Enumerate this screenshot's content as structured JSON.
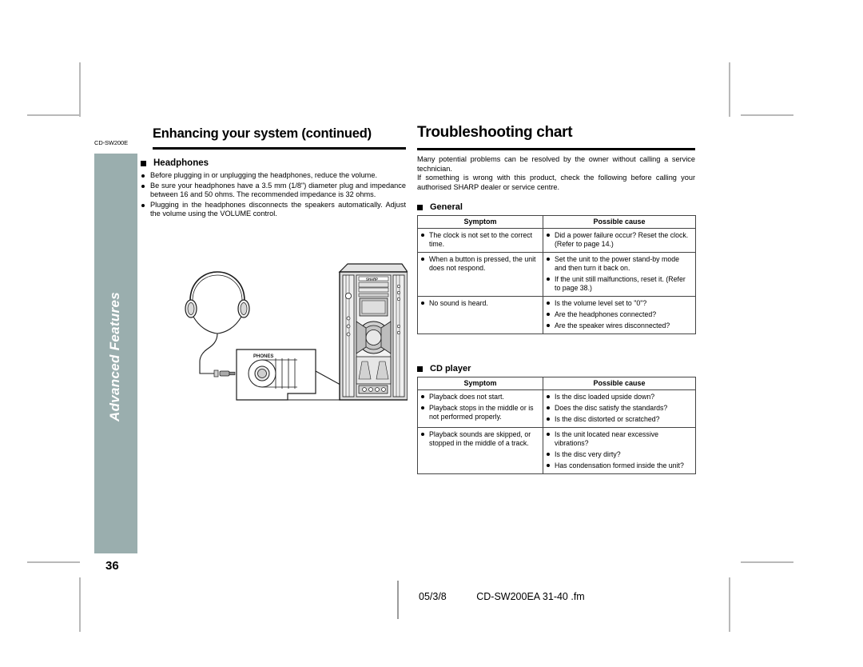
{
  "document": {
    "part_code": "CD-SW200E",
    "page_number": "36",
    "sidebar_label": "Advanced Features",
    "sidebar_color": "#9aaeae"
  },
  "left": {
    "title": "Enhancing your system (continued)",
    "headphones": {
      "heading": "Headphones",
      "bullets": [
        "Before plugging in or unplugging the headphones, reduce the volume.",
        "Be sure your headphones have a 3.5 mm (1/8\") diameter plug and impedance between 16 and 50 ohms. The recommended impedance is 32 ohms.",
        "Plugging in the headphones disconnects the speakers automatically. Adjust the volume using the VOLUME control."
      ]
    },
    "illustration": {
      "jack_label": "PHONES",
      "brand_label": "SHARP"
    }
  },
  "right": {
    "title": "Troubleshooting chart",
    "intro": [
      "Many potential problems can be resolved by the owner without calling a service technician.",
      "If something is wrong with this product, check the following before calling your authorised SHARP dealer or service centre."
    ],
    "sections": [
      {
        "heading": "General",
        "columns": [
          "Symptom",
          "Possible cause"
        ],
        "rows": [
          {
            "symptom": [
              "The clock is not set to the correct time."
            ],
            "cause": [
              "Did a power failure occur? Reset the clock. (Refer to page 14.)"
            ]
          },
          {
            "symptom": [
              "When a button is pressed, the unit does not respond."
            ],
            "cause": [
              "Set the unit to the power stand-by mode and then turn it back on.",
              "If the unit still malfunctions, reset it. (Refer to page 38.)"
            ]
          },
          {
            "symptom": [
              "No sound is heard."
            ],
            "cause": [
              "Is the volume level set to \"0\"?",
              "Are the headphones connected?",
              "Are the speaker wires disconnected?"
            ]
          }
        ]
      },
      {
        "heading": "CD player",
        "columns": [
          "Symptom",
          "Possible cause"
        ],
        "rows": [
          {
            "symptom": [
              "Playback does not start.",
              "Playback stops in the middle or is not performed properly."
            ],
            "cause": [
              "Is the disc loaded upside down?",
              "Does the disc satisfy the standards?",
              "Is the disc distorted or scratched?"
            ]
          },
          {
            "symptom": [
              "Playback sounds are skipped, or stopped in the middle of a track."
            ],
            "cause": [
              "Is the unit located near excessive vibrations?",
              "Is the disc very dirty?",
              "Has condensation formed inside the unit?"
            ]
          }
        ]
      }
    ]
  },
  "footer": {
    "date": "05/3/8",
    "filename": "CD-SW200EA 31-40 .fm"
  }
}
